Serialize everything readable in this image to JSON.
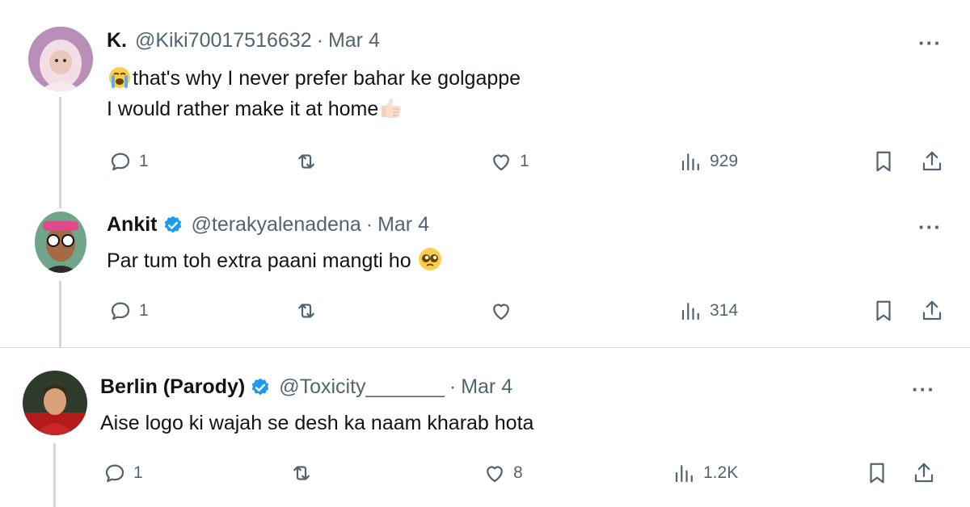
{
  "tweets": [
    {
      "name": "K.",
      "handle": "@Kiki70017516632",
      "separator": "·",
      "date": "Mar 4",
      "verified": false,
      "lines": [
        "that's why I never prefer bahar ke golgappe",
        "I would rather make it at home"
      ],
      "emojis": [
        "loudly-crying-face",
        "thumbs-up"
      ],
      "replies": "1",
      "retweets": "",
      "likes": "1",
      "views": "929",
      "more": "···"
    },
    {
      "name": "Ankit",
      "handle": "@terakyalenadena",
      "separator": "·",
      "date": "Mar 4",
      "verified": true,
      "lines": [
        "Par tum toh extra paani mangti ho"
      ],
      "emojis": [
        "pleading-face"
      ],
      "replies": "1",
      "retweets": "",
      "likes": "",
      "views": "314",
      "more": "···"
    },
    {
      "name": "Berlin (Parody)",
      "handle": "@Toxicity_______",
      "separator": "·",
      "date": "Mar 4",
      "verified": true,
      "lines": [
        "Aise logo ki wajah se desh ka naam kharab hota"
      ],
      "emojis": [],
      "replies": "1",
      "retweets": "",
      "likes": "8",
      "views": "1.2K",
      "more": "···"
    }
  ],
  "colors": {
    "text": "#0f1419",
    "secondary": "#536471",
    "verified": "#1d9bf0",
    "thread_line": "#cfd9de"
  }
}
